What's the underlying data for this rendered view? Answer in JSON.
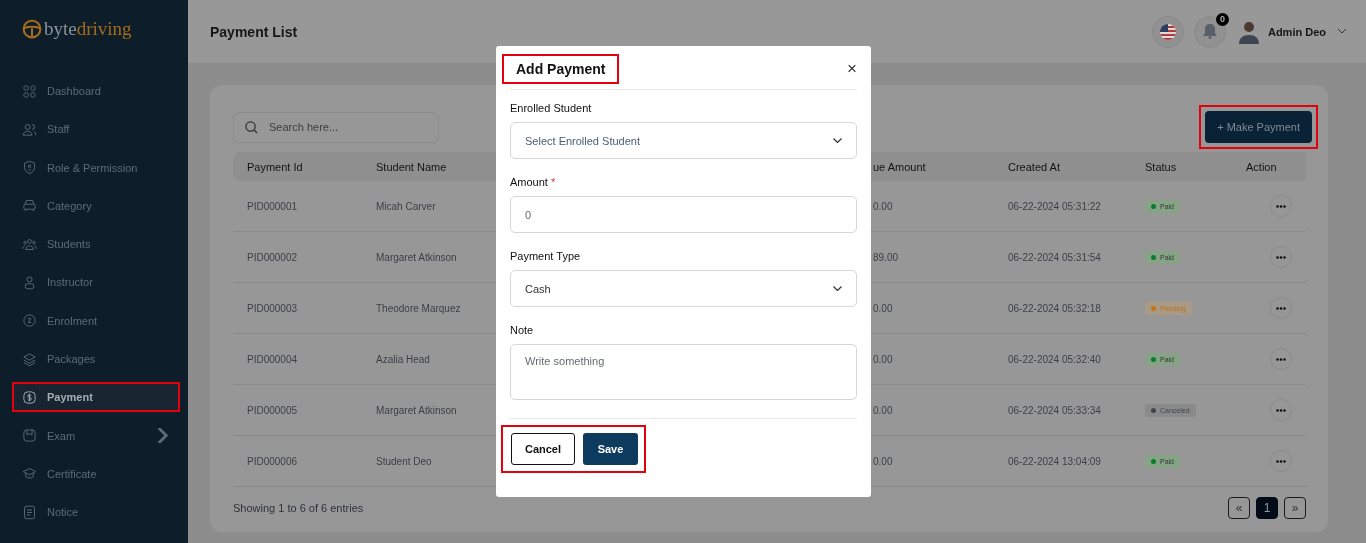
{
  "brand": {
    "part1": "byte",
    "part2": "driving"
  },
  "sidebar": {
    "items": [
      {
        "label": "Dashboard",
        "selected": false,
        "highlighted": false
      },
      {
        "label": "Staff",
        "selected": false,
        "highlighted": false
      },
      {
        "label": "Role & Permission",
        "selected": false,
        "highlighted": false
      },
      {
        "label": "Category",
        "selected": false,
        "highlighted": false
      },
      {
        "label": "Students",
        "selected": false,
        "highlighted": false
      },
      {
        "label": "Instructor",
        "selected": false,
        "highlighted": false
      },
      {
        "label": "Enrolment",
        "selected": false,
        "highlighted": false
      },
      {
        "label": "Packages",
        "selected": false,
        "highlighted": false
      },
      {
        "label": "Payment",
        "selected": true,
        "highlighted": true
      },
      {
        "label": "Exam",
        "selected": false,
        "highlighted": false,
        "expandable": true
      },
      {
        "label": "Certificate",
        "selected": false,
        "highlighted": false
      },
      {
        "label": "Notice",
        "selected": false,
        "highlighted": false
      }
    ]
  },
  "header": {
    "title": "Payment List",
    "notification_count": "0",
    "user_name": "Admin Deo"
  },
  "toolbar": {
    "search_placeholder": "Search here...",
    "make_payment": {
      "label": "+ Make Payment",
      "highlighted": true
    }
  },
  "table": {
    "columns": [
      "Payment Id",
      "Student Name",
      "ue Amount",
      "Created At",
      "Status",
      "Action"
    ],
    "rows": [
      {
        "id": "PID000001",
        "student": "Micah Carver",
        "due": "0.00",
        "created": "06-22-2024 05:31:22",
        "status": {
          "label": "Paid",
          "kind": "paid"
        }
      },
      {
        "id": "PID000002",
        "student": "Margaret Atkinson",
        "due": "89.00",
        "created": "06-22-2024 05:31:54",
        "status": {
          "label": "Paid",
          "kind": "paid"
        }
      },
      {
        "id": "PID000003",
        "student": "Theodore Marquez",
        "due": "0.00",
        "created": "06-22-2024 05:32:18",
        "status": {
          "label": "Pending",
          "kind": "pending"
        }
      },
      {
        "id": "PID000004",
        "student": "Azalia Head",
        "due": "0.00",
        "created": "06-22-2024 05:32:40",
        "status": {
          "label": "Paid",
          "kind": "paid"
        }
      },
      {
        "id": "PID000005",
        "student": "Margaret Atkinson",
        "due": "0.00",
        "created": "06-22-2024 05:33:34",
        "status": {
          "label": "Canceled",
          "kind": "canceled"
        }
      },
      {
        "id": "PID000006",
        "student": "Student Deo",
        "due": "0.00",
        "created": "06-22-2024 13:04:09",
        "status": {
          "label": "Paid",
          "kind": "paid"
        }
      }
    ]
  },
  "footer": {
    "entries": "Showing 1 to 6 of 6 entries",
    "pages": [
      {
        "label": "«",
        "selected": false
      },
      {
        "label": "1",
        "selected": true
      },
      {
        "label": "»",
        "selected": false
      }
    ]
  },
  "modal": {
    "title": "Add Payment",
    "title_highlighted": true,
    "close": "×",
    "fields": [
      {
        "kind": "select",
        "label": "Enrolled Student",
        "required": false,
        "placeholder": "Select Enrolled Student"
      },
      {
        "kind": "input",
        "label": "Amount",
        "required": true,
        "placeholder": "0"
      },
      {
        "kind": "select",
        "label": "Payment Type",
        "required": false,
        "value": "Cash"
      },
      {
        "kind": "textarea",
        "label": "Note",
        "required": false,
        "placeholder": "Write something"
      }
    ],
    "required_mark": "*",
    "cancel": "Cancel",
    "save": "Save",
    "actions_highlighted": true
  }
}
